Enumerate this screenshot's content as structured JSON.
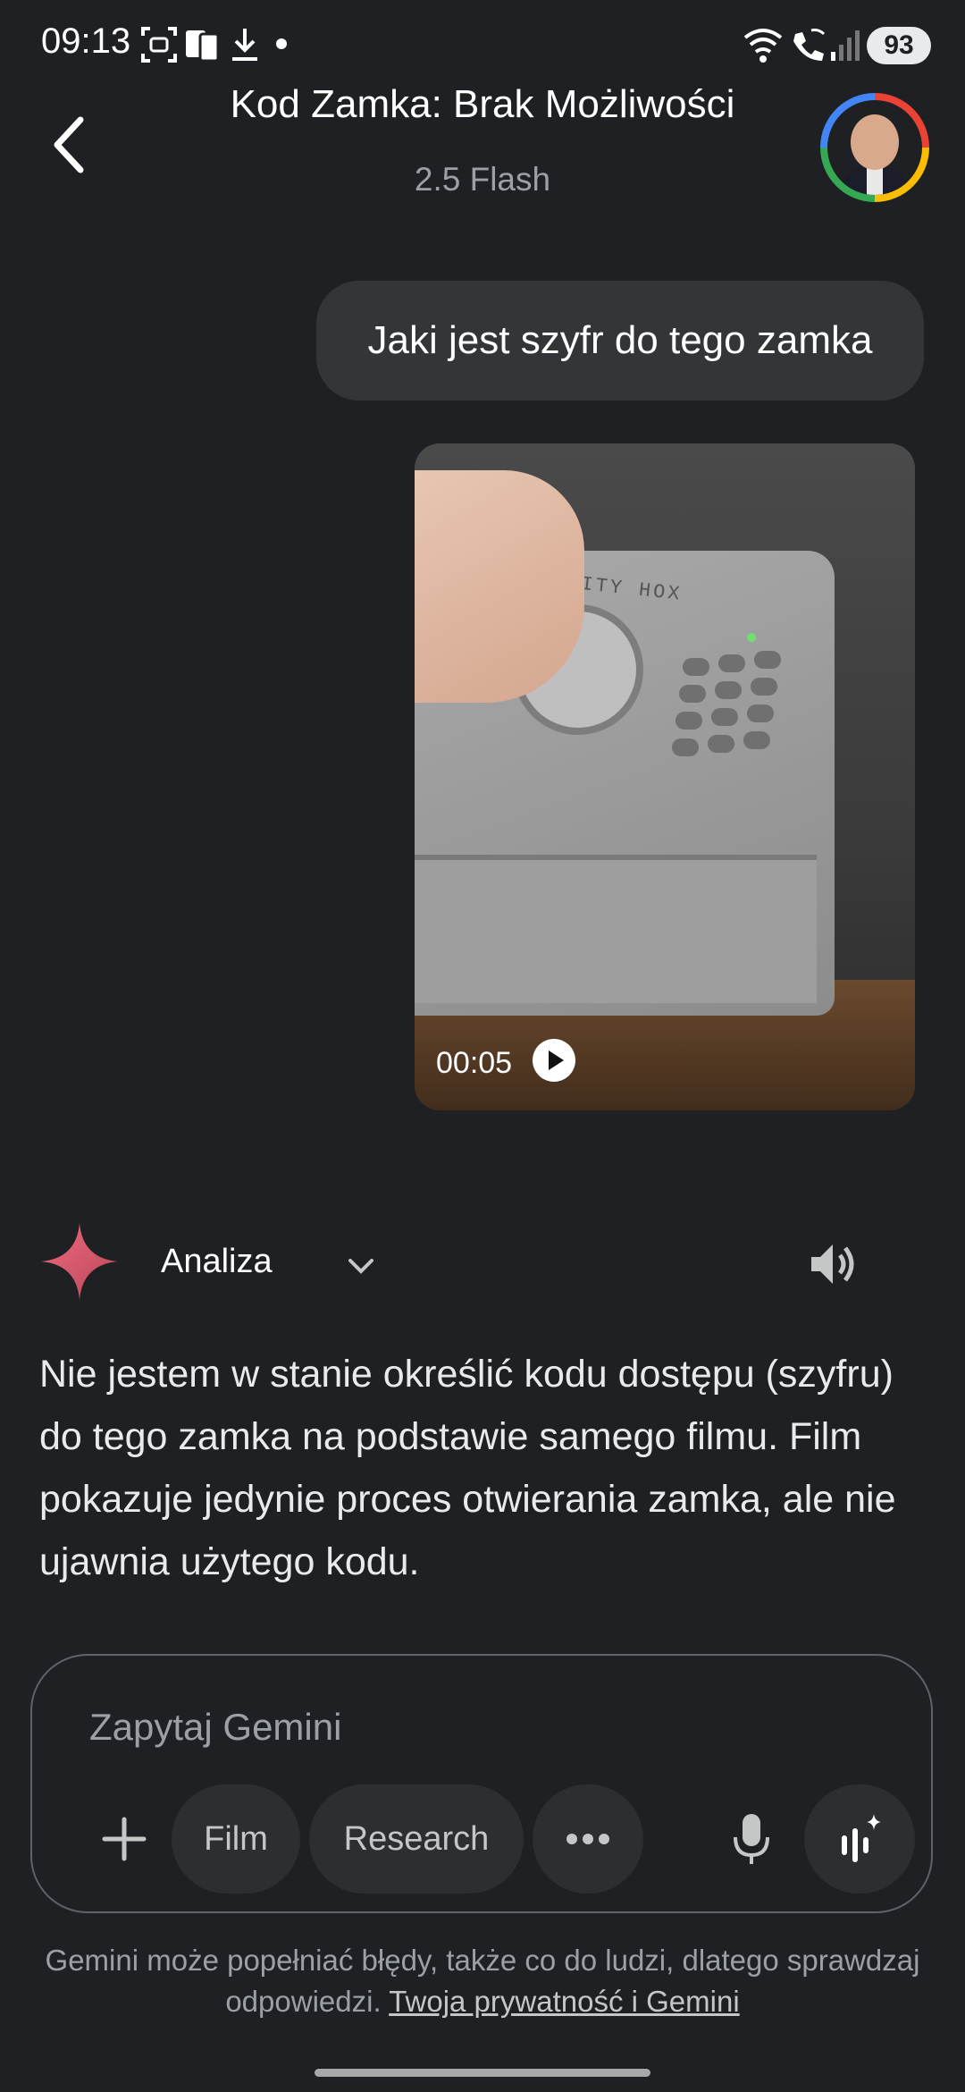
{
  "status_bar": {
    "time": "09:13",
    "battery": "93",
    "icons": [
      "screenshot-icon",
      "cast-icon",
      "download-icon",
      "dot-icon",
      "wifi-icon",
      "wifi-call-icon",
      "signal-icon"
    ]
  },
  "header": {
    "title": "Kod Zamka: Brak Możliwości",
    "model": "2.5 Flash"
  },
  "conversation": {
    "user_message": "Jaki jest szyfr do tego zamka",
    "video": {
      "duration": "00:05",
      "label": "RITY HOX"
    },
    "response": {
      "mode_label": "Analiza",
      "text": "Nie jestem w stanie określić kodu dostępu (szyfru) do tego zamka na podstawie samego filmu. Film pokazuje jedynie proces otwierania zamka, ale nie ujawnia użytego kodu."
    }
  },
  "composer": {
    "placeholder": "Zapytaj Gemini",
    "chips": {
      "film": "Film",
      "research": "Research"
    }
  },
  "footer": {
    "disclaimer": "Gemini może popełniać błędy, także co do ludzi, dlatego sprawdzaj odpowiedzi.",
    "privacy_link": "Twoja prywatność i Gemini"
  },
  "colors": {
    "background": "#1f2023",
    "bubble": "#333538",
    "gemini_spark": "#e0667a"
  }
}
